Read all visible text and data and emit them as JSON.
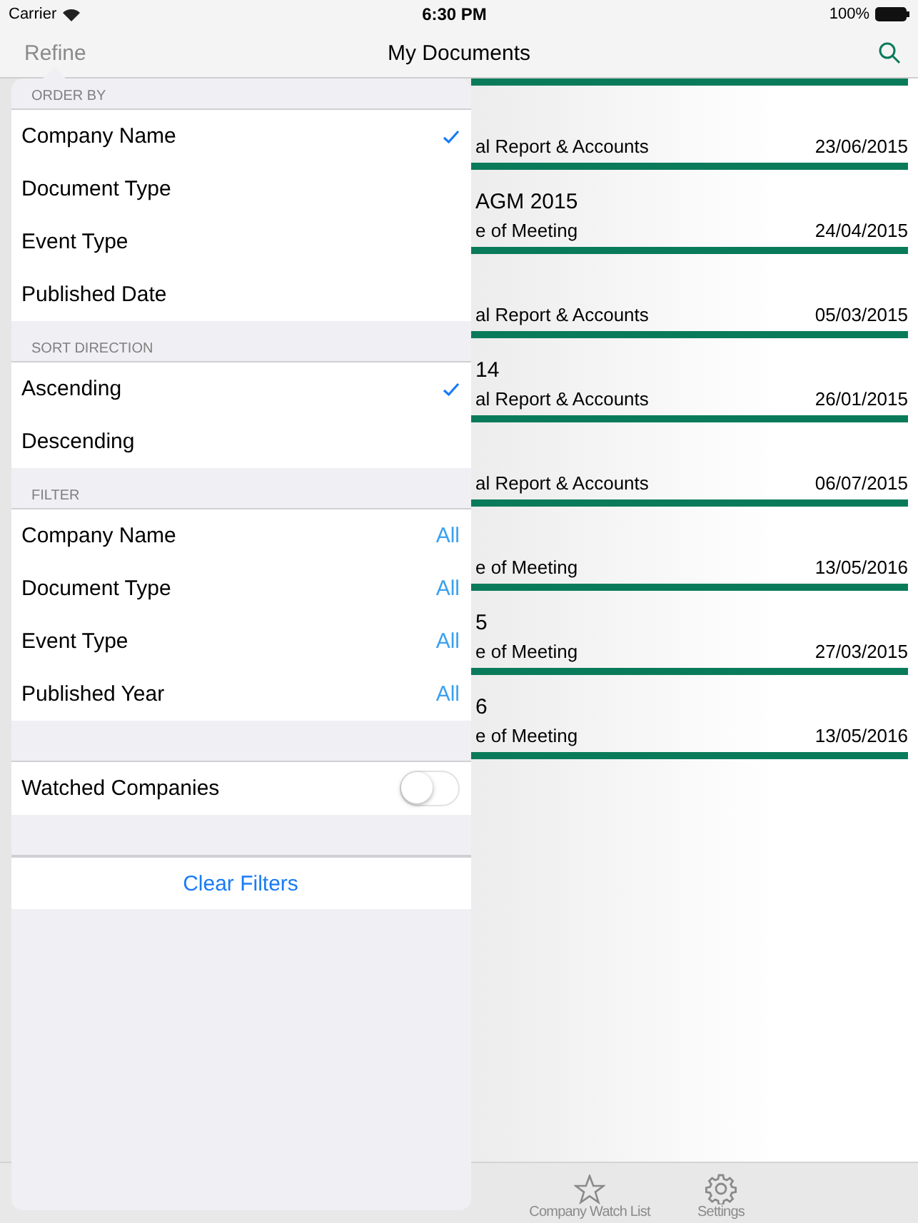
{
  "status_bar": {
    "carrier": "Carrier",
    "time": "6:30 PM",
    "battery": "100%"
  },
  "nav_bar": {
    "left_button": "Refine",
    "title": "My Documents"
  },
  "documents": [
    {
      "subtitle": "al Report & Accounts",
      "date": "23/06/2015"
    },
    {
      "title": "AGM 2015",
      "subtitle": "e of Meeting",
      "date": "24/04/2015"
    },
    {
      "subtitle": "al Report & Accounts",
      "date": "05/03/2015"
    },
    {
      "title": "14",
      "subtitle": "al Report & Accounts",
      "date": "26/01/2015"
    },
    {
      "subtitle": "al Report & Accounts",
      "date": "06/07/2015"
    },
    {
      "subtitle": "e of Meeting",
      "date": "13/05/2016"
    },
    {
      "title": "5",
      "subtitle": "e of Meeting",
      "date": "27/03/2015"
    },
    {
      "title": "6",
      "subtitle": "e of Meeting",
      "date": "13/05/2016"
    }
  ],
  "refine_popover": {
    "sections": [
      {
        "header": "ORDER BY",
        "items": [
          {
            "label": "Company Name",
            "kind": "check",
            "selected": true
          },
          {
            "label": "Document Type",
            "kind": "check",
            "selected": false
          },
          {
            "label": "Event Type",
            "kind": "check",
            "selected": false
          },
          {
            "label": "Published Date",
            "kind": "check",
            "selected": false
          }
        ]
      },
      {
        "header": "SORT DIRECTION",
        "items": [
          {
            "label": "Ascending",
            "kind": "check",
            "selected": true
          },
          {
            "label": "Descending",
            "kind": "check",
            "selected": false
          }
        ]
      },
      {
        "header": "FILTER",
        "items": [
          {
            "label": "Company Name",
            "kind": "value",
            "value": "All"
          },
          {
            "label": "Document Type",
            "kind": "value",
            "value": "All"
          },
          {
            "label": "Event Type",
            "kind": "value",
            "value": "All"
          },
          {
            "label": "Published Year",
            "kind": "value",
            "value": "All"
          }
        ]
      }
    ],
    "toggle": {
      "label": "Watched Companies",
      "on": false
    },
    "clear_button": "Clear Filters"
  },
  "tab_bar": [
    {
      "label": "Company Watch List",
      "kind": "star"
    },
    {
      "label": "Settings",
      "kind": "gear"
    }
  ]
}
